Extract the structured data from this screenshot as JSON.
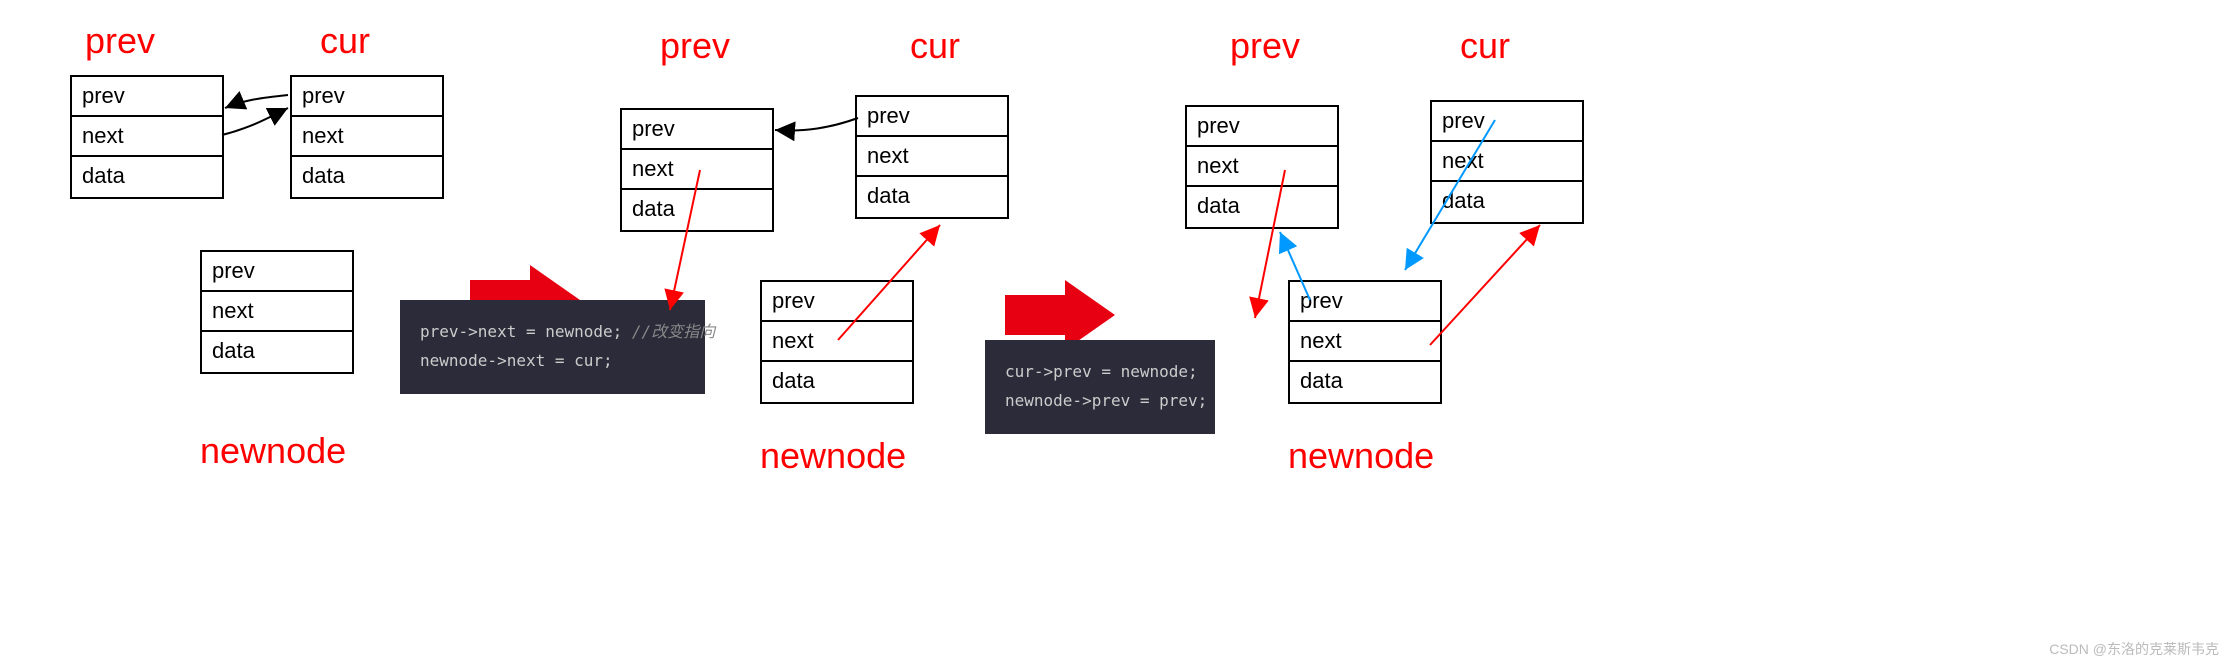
{
  "labels": {
    "prev1": "prev",
    "cur1": "cur",
    "newnode1": "newnode",
    "prev2": "prev",
    "cur2": "cur",
    "newnode2": "newnode",
    "prev3": "prev",
    "cur3": "cur",
    "newnode3": "newnode"
  },
  "node": {
    "field_prev": "prev",
    "field_next": "next",
    "field_data": "data"
  },
  "code1": {
    "line1a": "prev->next = newnode; ",
    "line1b": "//改变指向",
    "line2": "newnode->next = cur;"
  },
  "code2": {
    "line1": "cur->prev = newnode;",
    "line2": "newnode->prev = prev;"
  },
  "watermark": "CSDN @东洛的克莱斯韦克",
  "colors": {
    "red": "#ff0000",
    "blue": "#0099ff",
    "black": "#000000",
    "arrow_red_fill": "#e60012",
    "code_bg": "#2b2b3a"
  }
}
